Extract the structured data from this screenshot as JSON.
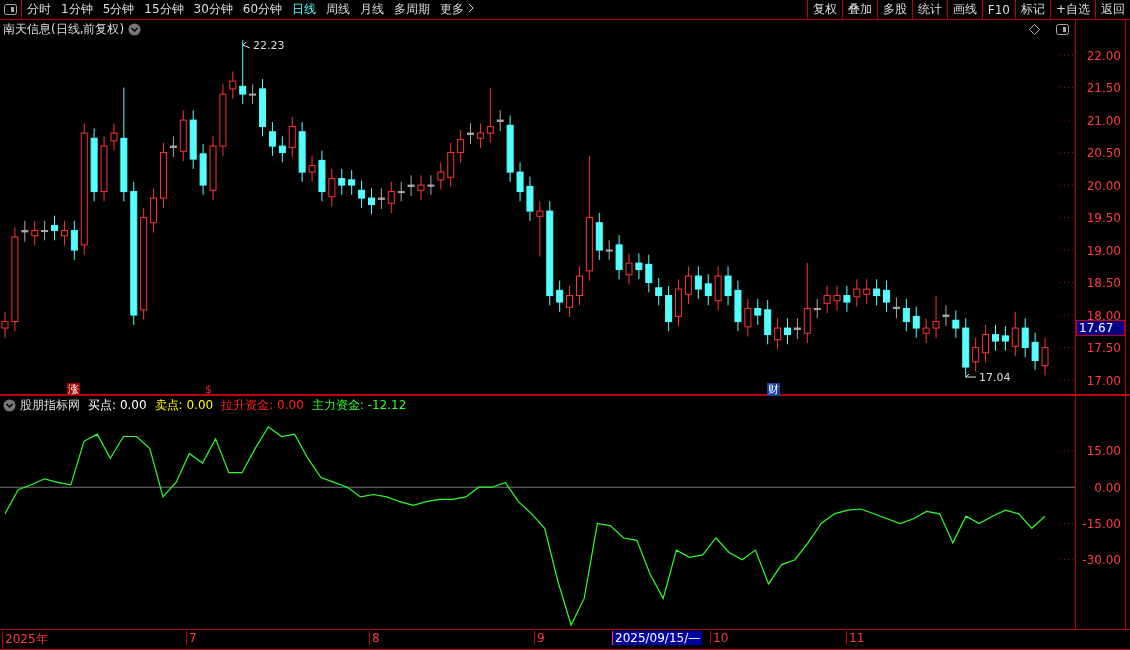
{
  "toolbar": {
    "periods": [
      {
        "label": "分时",
        "selected": false
      },
      {
        "label": "1分钟",
        "selected": false
      },
      {
        "label": "5分钟",
        "selected": false
      },
      {
        "label": "15分钟",
        "selected": false
      },
      {
        "label": "30分钟",
        "selected": false
      },
      {
        "label": "60分钟",
        "selected": false
      },
      {
        "label": "日线",
        "selected": true
      },
      {
        "label": "周线",
        "selected": false
      },
      {
        "label": "月线",
        "selected": false
      },
      {
        "label": "多周期",
        "selected": false
      }
    ],
    "more": "更多",
    "actions": [
      "复权",
      "叠加",
      "多股",
      "统计",
      "画线",
      "F10",
      "标记",
      "+自选",
      "返回"
    ]
  },
  "price_chart": {
    "title": "南天信息(日线,前复权)",
    "high_label": "22.23",
    "low_label": "17.04",
    "tags": [
      {
        "text": "涨",
        "kind": "boxed"
      },
      {
        "text": "$",
        "kind": "plain"
      },
      {
        "text": "财",
        "kind": "info"
      }
    ],
    "current_price": "17.67",
    "chart_data": {
      "type": "candlestick",
      "ylim": [
        16.77,
        22.54
      ],
      "yticks": [
        {
          "value": 22,
          "label": "22.00"
        },
        {
          "value": 21.5,
          "label": "21.50"
        },
        {
          "value": 21,
          "label": "21.00"
        },
        {
          "value": 20.5,
          "label": "20.50"
        },
        {
          "value": 20,
          "label": "20.00"
        },
        {
          "value": 19.5,
          "label": "19.50"
        },
        {
          "value": 19,
          "label": "19.00"
        },
        {
          "value": 18.5,
          "label": "18.50"
        },
        {
          "value": 18,
          "label": "18.00"
        },
        {
          "value": 17.5,
          "label": "17.50"
        },
        {
          "value": 17,
          "label": "17.00"
        }
      ],
      "categories": [
        null,
        null,
        null,
        null,
        null,
        null,
        null,
        null,
        null,
        null,
        null,
        null,
        null,
        null,
        null,
        null,
        null,
        null,
        null,
        null,
        null,
        null,
        null,
        null,
        null,
        null,
        null,
        null,
        null,
        null,
        null,
        null,
        null,
        null,
        null,
        null,
        null,
        null,
        null,
        null,
        null,
        null,
        null,
        null,
        null,
        null,
        null,
        null,
        null,
        null,
        null,
        null,
        null,
        null,
        null,
        null,
        null,
        null,
        null,
        null,
        null,
        null,
        null,
        null,
        null,
        null,
        null,
        null,
        null,
        null,
        null,
        null,
        null,
        null,
        null,
        null,
        null,
        null,
        null,
        null,
        null,
        null,
        null,
        null,
        null,
        null,
        null,
        null,
        null,
        null,
        null,
        null,
        null,
        null,
        null,
        null,
        null,
        null,
        null,
        null,
        null,
        null,
        null,
        null,
        null,
        null
      ],
      "ohlc": [
        [
          17.8,
          18.05,
          17.65,
          17.9
        ],
        [
          17.9,
          19.35,
          17.75,
          19.2
        ],
        [
          19.28,
          19.45,
          19.13,
          19.3
        ],
        [
          19.22,
          19.45,
          19.07,
          19.3
        ],
        [
          19.3,
          19.45,
          19.15,
          19.3
        ],
        [
          19.38,
          19.53,
          19.15,
          19.3
        ],
        [
          19.22,
          19.45,
          19.07,
          19.3
        ],
        [
          19.3,
          19.45,
          18.85,
          19.0
        ],
        [
          19.08,
          20.95,
          18.93,
          20.8
        ],
        [
          20.72,
          20.87,
          19.75,
          19.9
        ],
        [
          19.9,
          20.75,
          19.75,
          20.6
        ],
        [
          20.68,
          20.95,
          20.53,
          20.8
        ],
        [
          20.72,
          21.5,
          19.75,
          19.9
        ],
        [
          19.9,
          20.05,
          17.85,
          18.0
        ],
        [
          18.08,
          19.65,
          17.93,
          19.5
        ],
        [
          19.42,
          19.95,
          19.27,
          19.8
        ],
        [
          19.8,
          20.65,
          19.65,
          20.5
        ],
        [
          20.58,
          20.75,
          20.43,
          20.6
        ],
        [
          20.52,
          21.15,
          20.37,
          21.0
        ],
        [
          21.0,
          21.15,
          20.25,
          20.4
        ],
        [
          20.48,
          20.63,
          19.85,
          20.0
        ],
        [
          19.92,
          20.75,
          19.77,
          20.6
        ],
        [
          20.6,
          21.55,
          20.45,
          21.4
        ],
        [
          21.48,
          21.75,
          21.33,
          21.6
        ],
        [
          21.52,
          22.23,
          21.25,
          21.4
        ],
        [
          21.4,
          21.55,
          21.25,
          21.4
        ],
        [
          21.48,
          21.63,
          20.75,
          20.9
        ],
        [
          20.82,
          20.97,
          20.45,
          20.6
        ],
        [
          20.6,
          20.75,
          20.35,
          20.5
        ],
        [
          20.58,
          21.05,
          20.43,
          20.9
        ],
        [
          20.82,
          20.97,
          20.05,
          20.2
        ],
        [
          20.2,
          20.45,
          20.05,
          20.3
        ],
        [
          20.38,
          20.53,
          19.75,
          19.9
        ],
        [
          19.82,
          20.25,
          19.67,
          20.1
        ],
        [
          20.1,
          20.25,
          19.85,
          20.0
        ],
        [
          20.08,
          20.23,
          19.85,
          20.0
        ],
        [
          19.92,
          20.07,
          19.65,
          19.8
        ],
        [
          19.8,
          19.95,
          19.55,
          19.7
        ],
        [
          19.78,
          19.95,
          19.63,
          19.8
        ],
        [
          19.72,
          20.05,
          19.57,
          19.9
        ],
        [
          19.9,
          20.05,
          19.75,
          19.9
        ],
        [
          19.98,
          20.15,
          19.83,
          20.0
        ],
        [
          19.92,
          20.15,
          19.77,
          20.0
        ],
        [
          20.0,
          20.15,
          19.85,
          20.0
        ],
        [
          20.08,
          20.35,
          19.93,
          20.2
        ],
        [
          20.12,
          20.65,
          19.97,
          20.5
        ],
        [
          20.5,
          20.85,
          20.35,
          20.7
        ],
        [
          20.78,
          20.95,
          20.63,
          20.8
        ],
        [
          20.72,
          20.95,
          20.57,
          20.8
        ],
        [
          20.8,
          21.5,
          20.65,
          20.9
        ],
        [
          20.98,
          21.15,
          20.83,
          21.0
        ],
        [
          20.92,
          21.07,
          20.05,
          20.2
        ],
        [
          20.2,
          20.35,
          19.75,
          19.9
        ],
        [
          19.98,
          20.13,
          19.45,
          19.6
        ],
        [
          19.52,
          19.75,
          18.9,
          19.6
        ],
        [
          19.6,
          19.75,
          18.15,
          18.3
        ],
        [
          18.38,
          18.53,
          18.05,
          18.2
        ],
        [
          18.12,
          18.45,
          17.97,
          18.3
        ],
        [
          18.3,
          18.75,
          18.15,
          18.6
        ],
        [
          18.68,
          20.45,
          18.53,
          19.5
        ],
        [
          19.42,
          19.57,
          18.85,
          19.0
        ],
        [
          19.0,
          19.15,
          18.85,
          19.0
        ],
        [
          19.08,
          19.23,
          18.55,
          18.7
        ],
        [
          18.62,
          18.95,
          18.47,
          18.8
        ],
        [
          18.8,
          18.95,
          18.55,
          18.7
        ],
        [
          18.78,
          18.93,
          18.35,
          18.5
        ],
        [
          18.42,
          18.57,
          18.15,
          18.3
        ],
        [
          18.3,
          18.45,
          17.75,
          17.9
        ],
        [
          17.98,
          18.55,
          17.83,
          18.4
        ],
        [
          18.32,
          18.75,
          18.17,
          18.6
        ],
        [
          18.6,
          18.75,
          18.25,
          18.4
        ],
        [
          18.48,
          18.63,
          18.15,
          18.3
        ],
        [
          18.22,
          18.75,
          18.07,
          18.6
        ],
        [
          18.6,
          18.75,
          18.15,
          18.3
        ],
        [
          18.38,
          18.53,
          17.75,
          17.9
        ],
        [
          17.82,
          18.25,
          17.67,
          18.1
        ],
        [
          18.1,
          18.25,
          17.85,
          18.0
        ],
        [
          18.08,
          18.23,
          17.55,
          17.7
        ],
        [
          17.62,
          17.95,
          17.47,
          17.8
        ],
        [
          17.8,
          17.95,
          17.55,
          17.7
        ],
        [
          17.78,
          17.95,
          17.63,
          17.8
        ],
        [
          17.72,
          18.8,
          17.57,
          18.1
        ],
        [
          18.1,
          18.25,
          17.95,
          18.1
        ],
        [
          18.18,
          18.45,
          18.03,
          18.3
        ],
        [
          18.22,
          18.45,
          18.07,
          18.3
        ],
        [
          18.3,
          18.45,
          18.05,
          18.2
        ],
        [
          18.28,
          18.55,
          18.13,
          18.4
        ],
        [
          18.32,
          18.55,
          18.17,
          18.4
        ],
        [
          18.4,
          18.55,
          18.15,
          18.3
        ],
        [
          18.38,
          18.53,
          18.05,
          18.2
        ],
        [
          18.12,
          18.27,
          17.95,
          18.1
        ],
        [
          18.1,
          18.25,
          17.75,
          17.9
        ],
        [
          17.98,
          18.13,
          17.65,
          17.8
        ],
        [
          17.72,
          17.95,
          17.57,
          17.8
        ],
        [
          17.8,
          18.3,
          17.65,
          17.9
        ],
        [
          17.98,
          18.15,
          17.83,
          18.0
        ],
        [
          17.92,
          18.07,
          17.65,
          17.8
        ],
        [
          17.8,
          17.95,
          17.04,
          17.2
        ],
        [
          17.28,
          17.65,
          17.13,
          17.5
        ],
        [
          17.42,
          17.85,
          17.27,
          17.7
        ],
        [
          17.7,
          17.85,
          17.45,
          17.6
        ],
        [
          17.68,
          17.83,
          17.45,
          17.6
        ],
        [
          17.52,
          18.05,
          17.37,
          17.8
        ],
        [
          17.8,
          17.95,
          17.35,
          17.5
        ],
        [
          17.58,
          17.73,
          17.15,
          17.3
        ],
        [
          17.22,
          17.65,
          17.07,
          17.5
        ]
      ]
    }
  },
  "indicator": {
    "name": "股朋指标网",
    "legend": [
      {
        "label": "买点:",
        "value": "0.00",
        "color": "#ffffff"
      },
      {
        "label": "卖点:",
        "value": "0.00",
        "color": "#ffff00"
      },
      {
        "label": "拉升资金:",
        "value": "0.00",
        "color": "#ff2020"
      }
    ],
    "main_value": "-12.12",
    "chart_data": {
      "type": "line",
      "ylim": [
        -58.66,
        37.76
      ],
      "yticks": [
        {
          "value": 15,
          "label": "15.00"
        },
        {
          "value": 0,
          "label": "0.00"
        },
        {
          "value": -15,
          "label": "-15.00"
        },
        {
          "value": -30,
          "label": "-30.00"
        }
      ],
      "categories": [
        null,
        null,
        null,
        null,
        null,
        null,
        null,
        null,
        null,
        null,
        null,
        null,
        null,
        null,
        null,
        null,
        null,
        null,
        null,
        null,
        null,
        null,
        null,
        null,
        null,
        null,
        null,
        null,
        null,
        null,
        null,
        null,
        null,
        null,
        null,
        null,
        null,
        null,
        null,
        null,
        null,
        null,
        null,
        null,
        null,
        null,
        null,
        null,
        null,
        null,
        null,
        null,
        null,
        null,
        null,
        null,
        null,
        null,
        null,
        null,
        null,
        null,
        null,
        null,
        null,
        null,
        null,
        null,
        null,
        null,
        null,
        null,
        null,
        null,
        null,
        null,
        null,
        null,
        null,
        null
      ],
      "series": [
        {
          "name": "主力资金:",
          "color": "#2cff2c",
          "values": [
            -11,
            -1,
            1,
            3.5,
            2,
            1,
            19,
            22,
            12,
            21,
            21,
            16,
            -4,
            2,
            14,
            10,
            20,
            6,
            6,
            16,
            25,
            21,
            22,
            12,
            4,
            2,
            0,
            -4,
            -3,
            -4,
            -6,
            -7.5,
            -6,
            -5,
            -5,
            -4,
            0,
            0,
            2,
            -6,
            -11,
            -17,
            -39,
            -57,
            -46,
            -15,
            -16,
            -21,
            -22,
            -36,
            -46,
            -26,
            -29,
            -28,
            -21,
            -27,
            -30,
            -26,
            -40,
            -32,
            -30,
            -23,
            -15,
            -11,
            -9.5,
            -9,
            -11,
            -13,
            -15,
            -13,
            -10,
            -11,
            -23,
            -12,
            -15,
            -12,
            -9.5,
            -11,
            -17,
            -12
          ]
        }
      ]
    }
  },
  "time_axis": [
    {
      "label": "2025年",
      "highlighted": false
    },
    {
      "label": "7",
      "highlighted": false
    },
    {
      "label": "8",
      "highlighted": false
    },
    {
      "label": "9",
      "highlighted": false
    },
    {
      "label": "2025/09/15/—",
      "highlighted": true
    },
    {
      "label": "10",
      "highlighted": false
    },
    {
      "label": "11",
      "highlighted": false
    }
  ]
}
